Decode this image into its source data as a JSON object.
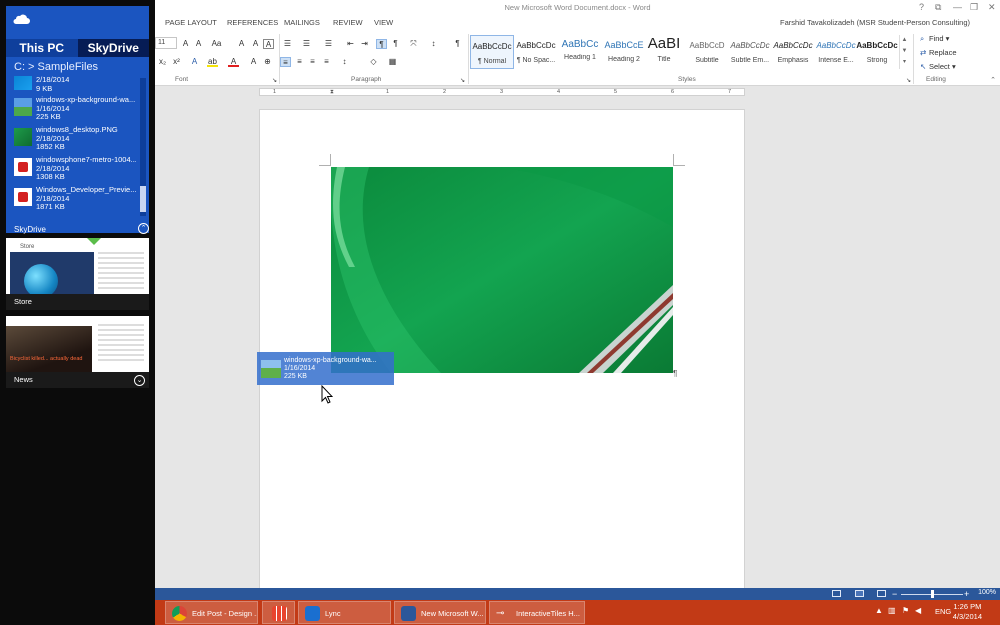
{
  "colors": {
    "skydrive_blue": "#1b55c0",
    "word_blue": "#2b579a",
    "taskbar": "#c23a16",
    "image_green": "#0f9446"
  },
  "skydrive": {
    "tabs": [
      "This PC",
      "SkyDrive"
    ],
    "path": "C: >  SampleFiles",
    "files": [
      {
        "name": "",
        "date": "2/18/2014",
        "size": "9 KB",
        "icon": "windows-file-icon"
      },
      {
        "name": "windows-xp-background-wa...",
        "date": "1/16/2014",
        "size": "225 KB",
        "icon": "image-file-icon"
      },
      {
        "name": "windows8_desktop.PNG",
        "date": "2/18/2014",
        "size": "1852 KB",
        "icon": "image-file-icon"
      },
      {
        "name": "windowsphone7-metro-1004...",
        "date": "2/18/2014",
        "size": "1308 KB",
        "icon": "pdf-file-icon"
      },
      {
        "name": "Windows_Developer_Previe...",
        "date": "2/18/2014",
        "size": "1871 KB",
        "icon": "pdf-file-icon"
      }
    ],
    "footer": "SkyDrive"
  },
  "tiles": {
    "store": {
      "title": "Store",
      "caption": "Store"
    },
    "news": {
      "title": "News",
      "headline": "Bicyclist killed... actually dead"
    }
  },
  "word": {
    "title": "New Microsoft Word Document.docx - Word",
    "user": "Farshid Tavakolizadeh (MSR Student-Person Consulting)",
    "window_controls": [
      "?",
      "⧉",
      "—",
      "❐",
      "✕"
    ],
    "tabs": [
      "PAGE LAYOUT",
      "REFERENCES",
      "MAILINGS",
      "REVIEW",
      "VIEW"
    ],
    "font_size": "11",
    "groups": [
      "Font",
      "Paragraph",
      "Styles",
      "Editing"
    ],
    "styles": [
      {
        "sample": "AaBbCcDc",
        "name": "¶ Normal"
      },
      {
        "sample": "AaBbCcDc",
        "name": "¶ No Spac..."
      },
      {
        "sample": "AaBbCc",
        "name": "Heading 1"
      },
      {
        "sample": "AaBbCcE",
        "name": "Heading 2"
      },
      {
        "sample": "AaBI",
        "name": "Title"
      },
      {
        "sample": "AaBbCcD",
        "name": "Subtitle"
      },
      {
        "sample": "AaBbCcDc",
        "name": "Subtle Em..."
      },
      {
        "sample": "AaBbCcDc",
        "name": "Emphasis"
      },
      {
        "sample": "AaBbCcDc",
        "name": "Intense E..."
      },
      {
        "sample": "AaBbCcDc",
        "name": "Strong"
      }
    ],
    "editing": [
      "Find",
      "Replace",
      "Select"
    ],
    "ruler": [
      "1",
      "1",
      "2",
      "3",
      "4",
      "5",
      "6",
      "7"
    ],
    "zoom": "100%"
  },
  "drag": {
    "name": "windows-xp-background-wa...",
    "date": "1/16/2014",
    "size": "225 KB"
  },
  "taskbar": {
    "items": [
      "Edit Post - Design ...",
      "",
      "Lync",
      "New Microsoft W...",
      "InteractiveTiles H..."
    ],
    "language": "ENG",
    "time": "1:26 PM",
    "date": "4/3/2014"
  }
}
